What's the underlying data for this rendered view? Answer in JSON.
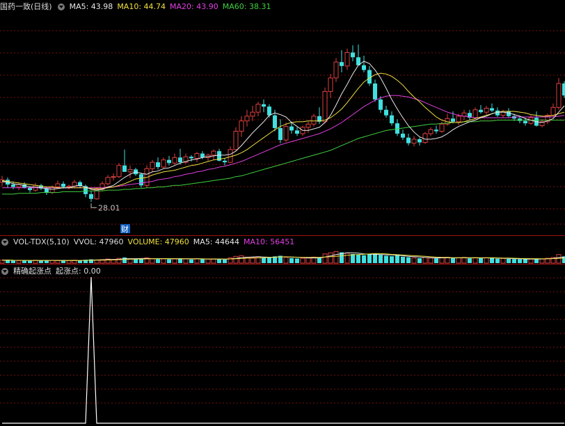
{
  "colors": {
    "title": "#dcdcdc",
    "ma5": "#e8e8e8",
    "ma10": "#f0e040",
    "ma20": "#e040e0",
    "ma60": "#40d040",
    "up": "#e04040",
    "down": "#40e0e0",
    "grid": "#7a1010",
    "annotation": "#c0c0c0",
    "badge_bg": "#1060c0",
    "indicator": "#ffffff"
  },
  "price_panel": {
    "title": "国药一致(日线)",
    "ma5_label": "MA5: 43.98",
    "ma10_label": "MA10: 44.74",
    "ma20_label": "MA20: 43.90",
    "ma60_label": "MA60: 38.31",
    "low_annotation": "28.01",
    "event_badge": "财"
  },
  "volume_panel": {
    "title": "VOL-TDX(5,10)",
    "vvol_label": "VVOL: 47960",
    "volume_label": "VOLUME: 47960",
    "ma5_label": "MA5: 44644",
    "ma10_label": "MA10: 56451"
  },
  "indicator_panel": {
    "title": "精确起涨点",
    "value_label": "起涨点: 0.00"
  },
  "chart_data": [
    {
      "type": "candlestick",
      "ylim": [
        24,
        52
      ],
      "low_marker": 28.01,
      "ohlc": [
        [
          30.5,
          31.3,
          30.0,
          30.8
        ],
        [
          30.8,
          31.1,
          29.8,
          30.2
        ],
        [
          30.2,
          30.6,
          29.6,
          29.9
        ],
        [
          29.9,
          30.4,
          29.5,
          30.2
        ],
        [
          30.2,
          30.5,
          29.7,
          29.8
        ],
        [
          29.8,
          30.0,
          29.2,
          29.5
        ],
        [
          29.5,
          30.4,
          29.3,
          30.1
        ],
        [
          30.1,
          30.3,
          29.5,
          29.7
        ],
        [
          29.7,
          29.9,
          28.9,
          29.2
        ],
        [
          29.2,
          30.1,
          29.0,
          29.9
        ],
        [
          29.9,
          30.7,
          29.7,
          30.3
        ],
        [
          30.3,
          30.6,
          29.7,
          29.9
        ],
        [
          29.9,
          30.2,
          29.6,
          30.0
        ],
        [
          30.0,
          30.8,
          29.8,
          30.5
        ],
        [
          30.5,
          30.7,
          29.8,
          30.0
        ],
        [
          30.0,
          30.2,
          28.6,
          29.0
        ],
        [
          29.0,
          29.4,
          28.0,
          28.4
        ],
        [
          28.4,
          29.9,
          28.3,
          29.6
        ],
        [
          29.6,
          30.6,
          29.4,
          30.3
        ],
        [
          30.3,
          31.4,
          30.1,
          31.1
        ],
        [
          31.1,
          31.6,
          30.7,
          31.2
        ],
        [
          31.2,
          32.9,
          31.0,
          32.6
        ],
        [
          32.6,
          34.6,
          31.8,
          31.8
        ],
        [
          31.8,
          32.6,
          31.0,
          32.1
        ],
        [
          32.1,
          32.3,
          31.3,
          31.5
        ],
        [
          31.5,
          31.7,
          29.8,
          30.1
        ],
        [
          30.1,
          32.6,
          29.8,
          32.2
        ],
        [
          32.2,
          33.3,
          31.8,
          33.0
        ],
        [
          33.0,
          33.6,
          32.1,
          32.4
        ],
        [
          32.4,
          33.6,
          32.2,
          33.3
        ],
        [
          33.3,
          33.8,
          32.6,
          32.9
        ],
        [
          32.9,
          34.1,
          32.7,
          33.6
        ],
        [
          33.6,
          34.7,
          32.7,
          33.0
        ],
        [
          33.0,
          34.1,
          32.8,
          33.7
        ],
        [
          33.7,
          33.9,
          33.1,
          33.5
        ],
        [
          33.5,
          34.3,
          33.0,
          34.1
        ],
        [
          34.1,
          34.4,
          33.4,
          33.6
        ],
        [
          33.6,
          34.1,
          33.2,
          33.9
        ],
        [
          33.9,
          34.6,
          33.3,
          34.4
        ],
        [
          34.4,
          34.7,
          33.1,
          33.2
        ],
        [
          33.2,
          33.5,
          32.6,
          33.0
        ],
        [
          33.0,
          35.0,
          32.9,
          34.6
        ],
        [
          34.6,
          37.4,
          34.4,
          36.9
        ],
        [
          36.9,
          38.8,
          36.2,
          38.2
        ],
        [
          38.2,
          39.6,
          37.5,
          38.8
        ],
        [
          38.8,
          40.1,
          38.2,
          39.3
        ],
        [
          39.3,
          40.6,
          38.8,
          40.3
        ],
        [
          40.3,
          40.9,
          39.3,
          40.0
        ],
        [
          40.0,
          40.3,
          38.6,
          38.9
        ],
        [
          38.9,
          39.6,
          36.9,
          37.3
        ],
        [
          37.3,
          38.4,
          35.4,
          35.8
        ],
        [
          35.8,
          38.0,
          35.6,
          37.5
        ],
        [
          37.5,
          38.1,
          36.6,
          37.0
        ],
        [
          37.0,
          37.4,
          36.3,
          36.6
        ],
        [
          36.6,
          37.6,
          36.3,
          37.4
        ],
        [
          37.4,
          38.1,
          36.7,
          37.8
        ],
        [
          37.8,
          39.1,
          37.5,
          38.8
        ],
        [
          38.8,
          39.9,
          37.8,
          38.1
        ],
        [
          38.1,
          42.4,
          37.9,
          41.9
        ],
        [
          41.9,
          44.1,
          41.1,
          43.6
        ],
        [
          43.6,
          46.1,
          43.1,
          45.6
        ],
        [
          45.6,
          47.1,
          44.3,
          45.1
        ],
        [
          45.1,
          47.3,
          44.6,
          46.8
        ],
        [
          46.8,
          47.7,
          45.7,
          46.2
        ],
        [
          46.2,
          47.8,
          45.6,
          45.2
        ],
        [
          45.2,
          46.4,
          44.3,
          44.6
        ],
        [
          44.6,
          45.1,
          42.6,
          42.9
        ],
        [
          42.9,
          43.4,
          40.6,
          40.9
        ],
        [
          40.9,
          41.3,
          39.2,
          39.6
        ],
        [
          39.6,
          40.1,
          38.6,
          38.9
        ],
        [
          38.9,
          39.4,
          37.6,
          37.9
        ],
        [
          37.9,
          38.4,
          36.3,
          36.6
        ],
        [
          36.6,
          37.1,
          35.8,
          36.1
        ],
        [
          36.1,
          36.6,
          35.1,
          35.4
        ],
        [
          35.4,
          36.3,
          35.0,
          35.9
        ],
        [
          35.9,
          36.1,
          35.1,
          35.5
        ],
        [
          35.5,
          36.8,
          35.3,
          36.6
        ],
        [
          36.6,
          37.4,
          36.3,
          37.1
        ],
        [
          37.1,
          37.6,
          36.6,
          36.9
        ],
        [
          36.9,
          38.1,
          36.7,
          37.8
        ],
        [
          37.8,
          39.1,
          37.6,
          38.5
        ],
        [
          38.5,
          39.4,
          37.9,
          38.1
        ],
        [
          38.1,
          39.1,
          37.7,
          38.8
        ],
        [
          38.8,
          39.6,
          38.3,
          39.2
        ],
        [
          39.2,
          39.6,
          38.3,
          38.6
        ],
        [
          38.6,
          39.9,
          38.4,
          39.6
        ],
        [
          39.6,
          40.2,
          39.1,
          39.3
        ],
        [
          39.3,
          40.1,
          39.0,
          39.8
        ],
        [
          39.8,
          40.4,
          39.3,
          39.5
        ],
        [
          39.5,
          39.9,
          38.7,
          38.9
        ],
        [
          38.9,
          39.6,
          38.6,
          39.4
        ],
        [
          39.4,
          39.8,
          38.6,
          38.8
        ],
        [
          38.8,
          39.1,
          38.2,
          38.5
        ],
        [
          38.5,
          38.8,
          37.9,
          38.2
        ],
        [
          38.2,
          38.6,
          37.6,
          37.9
        ],
        [
          37.9,
          38.9,
          37.7,
          38.6
        ],
        [
          38.6,
          39.4,
          37.5,
          37.6
        ],
        [
          37.6,
          38.4,
          37.4,
          38.1
        ],
        [
          38.1,
          39.1,
          37.8,
          38.9
        ],
        [
          38.9,
          40.4,
          38.7,
          39.9
        ],
        [
          39.9,
          43.6,
          39.6,
          42.9
        ],
        [
          42.9,
          43.2,
          41.1,
          41.4
        ]
      ],
      "ma5": [
        30.6,
        30.5,
        30.3,
        30.2,
        30.1,
        29.9,
        29.9,
        29.8,
        29.7,
        29.6,
        29.7,
        29.8,
        29.8,
        30.0,
        30.1,
        29.9,
        29.6,
        29.5,
        29.6,
        29.9,
        30.1,
        30.6,
        31.1,
        31.5,
        31.8,
        31.6,
        31.5,
        31.8,
        31.9,
        32.2,
        32.3,
        32.6,
        32.9,
        33.1,
        33.3,
        33.4,
        33.6,
        33.7,
        33.8,
        33.9,
        33.9,
        34.0,
        34.4,
        35.1,
        35.9,
        36.7,
        37.4,
        38.1,
        38.9,
        39.2,
        39.0,
        38.7,
        38.0,
        37.5,
        37.0,
        37.0,
        37.2,
        37.4,
        38.0,
        38.9,
        40.2,
        41.6,
        42.8,
        44.1,
        45.2,
        45.7,
        45.4,
        44.6,
        43.6,
        42.3,
        40.9,
        39.7,
        38.6,
        37.6,
        36.8,
        36.2,
        35.9,
        35.9,
        36.0,
        36.2,
        36.6,
        37.1,
        37.5,
        37.8,
        38.1,
        38.3,
        38.6,
        38.8,
        39.1,
        39.3,
        39.3,
        39.2,
        39.0,
        38.8,
        38.5,
        38.3,
        38.1,
        38.0,
        38.2,
        38.5,
        39.3,
        40.1
      ],
      "ma10": [
        30.7,
        30.6,
        30.5,
        30.4,
        30.3,
        30.2,
        30.1,
        30.0,
        29.9,
        29.9,
        29.8,
        29.8,
        29.8,
        29.8,
        29.8,
        29.8,
        29.7,
        29.7,
        29.7,
        29.8,
        29.9,
        30.1,
        30.3,
        30.6,
        30.9,
        31.0,
        31.1,
        31.4,
        31.6,
        31.8,
        31.9,
        32.0,
        32.2,
        32.4,
        32.6,
        32.7,
        32.9,
        33.1,
        33.3,
        33.4,
        33.5,
        33.7,
        33.9,
        34.2,
        34.6,
        35.1,
        35.6,
        36.1,
        36.6,
        37.1,
        37.5,
        37.8,
        38.0,
        38.1,
        38.1,
        38.2,
        38.2,
        38.2,
        38.3,
        38.6,
        39.1,
        39.7,
        40.5,
        41.4,
        42.3,
        43.1,
        43.6,
        44.0,
        44.2,
        44.1,
        43.8,
        43.3,
        42.7,
        41.9,
        41.2,
        40.6,
        39.9,
        39.3,
        38.7,
        38.3,
        38.1,
        38.0,
        38.0,
        38.1,
        38.3,
        38.5,
        38.7,
        38.9,
        39.1,
        39.3,
        39.4,
        39.4,
        39.4,
        39.3,
        39.2,
        39.0,
        38.9,
        38.8,
        38.8,
        38.9,
        39.1,
        39.3
      ],
      "ma20": [
        29.8,
        29.8,
        29.8,
        29.8,
        29.8,
        29.8,
        29.8,
        29.8,
        29.8,
        29.8,
        29.8,
        29.8,
        29.8,
        29.8,
        29.8,
        29.8,
        29.8,
        29.8,
        29.8,
        29.9,
        29.9,
        30.0,
        30.1,
        30.2,
        30.3,
        30.4,
        30.5,
        30.6,
        30.8,
        30.9,
        31.0,
        31.2,
        31.3,
        31.5,
        31.6,
        31.8,
        31.9,
        32.1,
        32.2,
        32.4,
        32.5,
        32.7,
        32.9,
        33.1,
        33.4,
        33.7,
        34.0,
        34.3,
        34.6,
        34.9,
        35.2,
        35.4,
        35.6,
        35.8,
        36.0,
        36.2,
        36.4,
        36.6,
        36.9,
        37.2,
        37.6,
        38.0,
        38.5,
        39.0,
        39.5,
        40.0,
        40.4,
        40.8,
        41.1,
        41.3,
        41.4,
        41.4,
        41.3,
        41.2,
        41.0,
        40.8,
        40.5,
        40.2,
        39.9,
        39.6,
        39.3,
        39.1,
        38.9,
        38.8,
        38.7,
        38.6,
        38.6,
        38.6,
        38.6,
        38.6,
        38.6,
        38.6,
        38.7,
        38.7,
        38.7,
        38.7,
        38.7,
        38.7,
        38.7,
        38.7,
        38.8,
        38.9
      ],
      "ma60": [
        29.0,
        29.0,
        29.0,
        29.1,
        29.1,
        29.1,
        29.1,
        29.2,
        29.2,
        29.2,
        29.2,
        29.3,
        29.3,
        29.3,
        29.3,
        29.4,
        29.4,
        29.4,
        29.4,
        29.5,
        29.5,
        29.5,
        29.6,
        29.6,
        29.7,
        29.7,
        29.8,
        29.8,
        29.9,
        29.9,
        30.0,
        30.1,
        30.1,
        30.2,
        30.3,
        30.4,
        30.5,
        30.6,
        30.7,
        30.8,
        30.9,
        31.0,
        31.2,
        31.3,
        31.5,
        31.7,
        31.9,
        32.1,
        32.3,
        32.5,
        32.7,
        32.9,
        33.1,
        33.3,
        33.5,
        33.7,
        33.9,
        34.1,
        34.3,
        34.5,
        34.8,
        35.1,
        35.4,
        35.7,
        36.0,
        36.2,
        36.4,
        36.6,
        36.8,
        37.0,
        37.1,
        37.2,
        37.3,
        37.4,
        37.5,
        37.6,
        37.7,
        37.8,
        37.8,
        37.9,
        37.9,
        38.0,
        38.0,
        38.1,
        38.1,
        38.1,
        38.2,
        38.2,
        38.2,
        38.3,
        38.3,
        38.3,
        38.3,
        38.3,
        38.3,
        38.3,
        38.3,
        38.3,
        38.3,
        38.3,
        38.3,
        38.3
      ]
    },
    {
      "type": "bar",
      "ylim": [
        0,
        250000
      ],
      "volume": [
        48000,
        52000,
        41000,
        39000,
        45000,
        38000,
        47000,
        42000,
        50000,
        46000,
        40000,
        44000,
        39000,
        48000,
        43000,
        55000,
        62000,
        51000,
        58000,
        66000,
        60000,
        78000,
        92000,
        70000,
        64000,
        72000,
        85000,
        74000,
        66000,
        70000,
        62000,
        75000,
        80000,
        68000,
        60000,
        72000,
        64000,
        66000,
        70000,
        62000,
        58000,
        85000,
        110000,
        120000,
        98000,
        90000,
        105000,
        88000,
        94000,
        110000,
        120000,
        96000,
        82000,
        76000,
        80000,
        84000,
        98000,
        90000,
        150000,
        168000,
        190000,
        176000,
        162000,
        150000,
        138000,
        128000,
        145000,
        156000,
        134000,
        120000,
        112000,
        126000,
        104000,
        96000,
        86000,
        80000,
        92000,
        84000,
        78000,
        90000,
        96000,
        82000,
        88000,
        94000,
        78000,
        90000,
        84000,
        88000,
        80000,
        72000,
        76000,
        70000,
        66000,
        62000,
        64000,
        70000,
        74000,
        68000,
        80000,
        92000,
        140000,
        110000
      ]
    },
    {
      "type": "line",
      "ylim": [
        0,
        1
      ],
      "value": 0.0,
      "spike_index": 16
    }
  ]
}
